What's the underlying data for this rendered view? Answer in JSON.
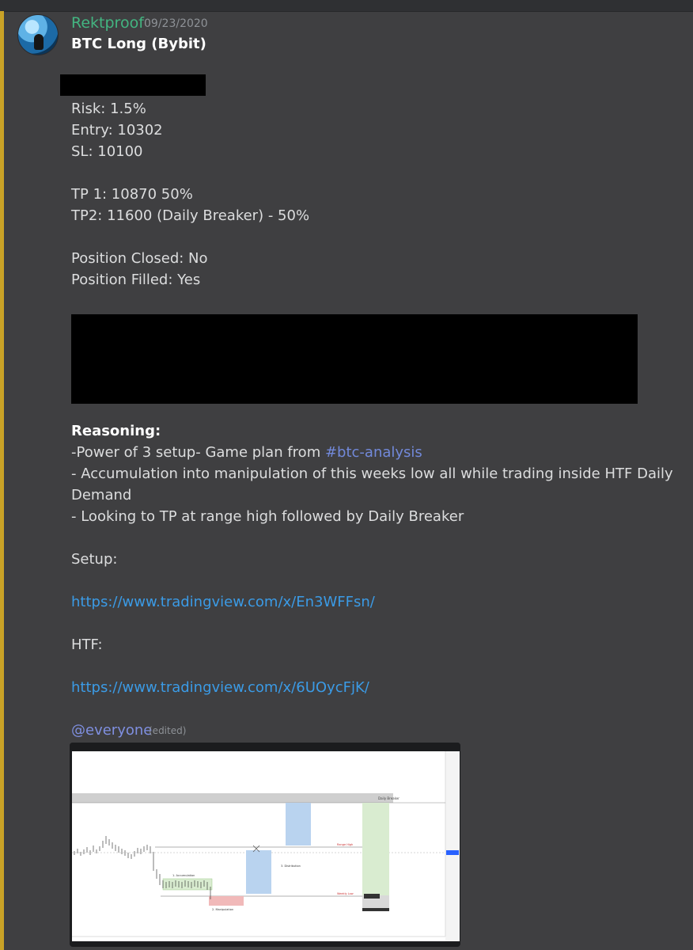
{
  "message": {
    "username": "Rektproof",
    "timestamp": "09/23/2020",
    "title": "BTC Long (Bybit)",
    "lines": {
      "risk": "Risk: 1.5%",
      "entry": "Entry: 10302",
      "sl": "SL: 10100",
      "tp1": "TP 1: 10870 50%",
      "tp2": "TP2: 11600 (Daily Breaker) - 50%",
      "closed": "Position Closed: No",
      "filled": "Position Filled: Yes"
    },
    "reasoning": {
      "heading": "Reasoning:",
      "line1_prefix": "-Power of 3 setup- Game plan from ",
      "line1_channel": "#btc-analysis",
      "line2": "- Accumulation into manipulation of this weeks low all while trading inside HTF Daily",
      "line2_cont": "Demand",
      "line3": "- Looking to TP at range high followed by Daily Breaker"
    },
    "setup_label": "Setup:",
    "setup_link": "https://www.tradingview.com/x/En3WFFsn/",
    "htf_label": "HTF:",
    "htf_link": "https://www.tradingview.com/x/6UOycFjK/",
    "mention": "@everyone",
    "edited": "(edited)"
  },
  "chart_image": {
    "labels": {
      "accumulation": "1. Accumulation",
      "manipulation": "2. Manipulation",
      "distribution": "3. Distribution",
      "daily_breaker": "Daily Breaker",
      "range_high": "Range High",
      "weekly_low": "Weekly Low"
    },
    "colors": {
      "background": "#ffffff",
      "grey_band": "#cfcfcf",
      "green_zone": "#d9ecd0",
      "red_zone": "#f1b9b9",
      "blue_zone": "#b9d3ef"
    }
  }
}
